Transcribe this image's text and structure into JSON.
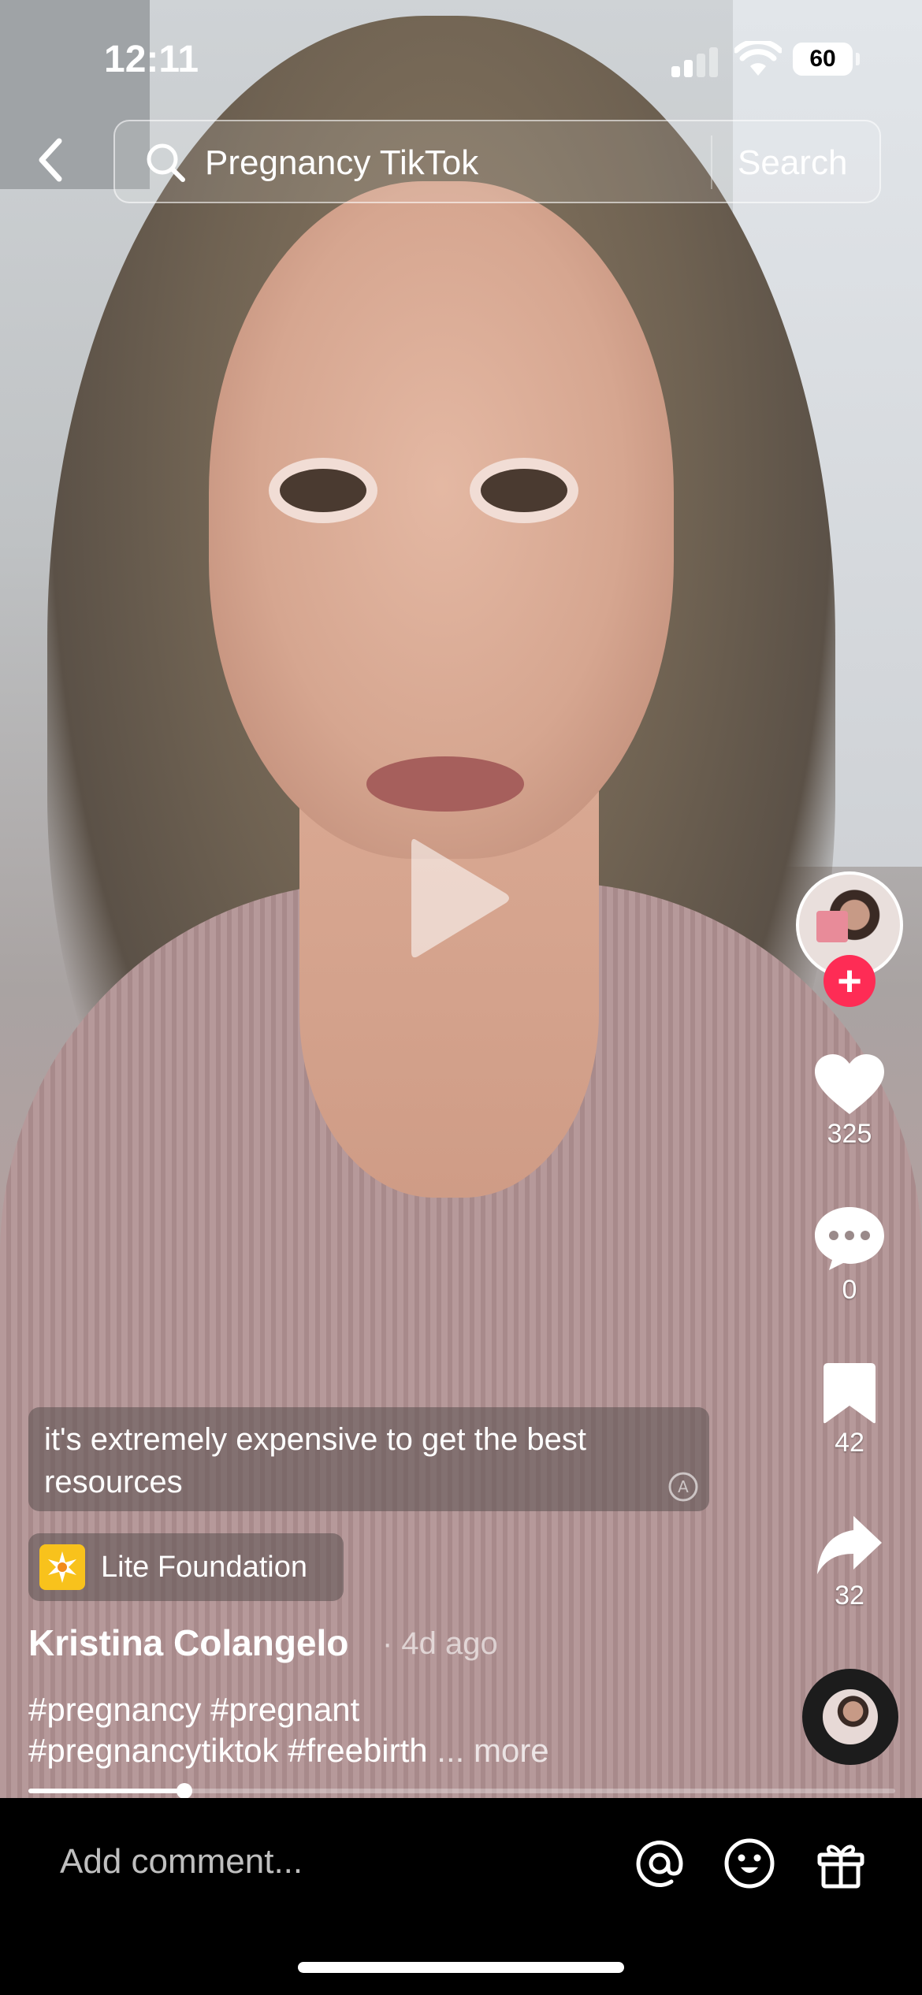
{
  "status_bar": {
    "time": "12:11",
    "battery": "60"
  },
  "search": {
    "query": "Pregnancy TikTok",
    "button_label": "Search"
  },
  "rail": {
    "likes": "325",
    "comments": "0",
    "saves": "42",
    "shares": "32",
    "follow_symbol": "+"
  },
  "caption": {
    "text": "it's extremely expensive to get the best resources"
  },
  "effect": {
    "label": "Lite Foundation"
  },
  "post": {
    "author": "Kristina Colangelo",
    "age": "· 4d ago",
    "hashtags_line1": "#pregnancy #pregnant",
    "hashtags_line2": "#pregnancytiktok #freebirth",
    "more_label": "... more"
  },
  "playback": {
    "progress": 0.18
  },
  "comment_bar": {
    "placeholder": "Add comment..."
  },
  "icons": {
    "back": "chevron-left-icon",
    "search": "search-icon",
    "play": "play-icon",
    "like": "heart-icon",
    "comment": "comment-bubble-icon",
    "save": "bookmark-icon",
    "share": "share-arrow-icon",
    "mention": "at-sign-icon",
    "emoji": "emoji-icon",
    "gift": "gift-icon"
  },
  "colors": {
    "follow_accent": "#fe2c55",
    "effect_badge": "#f8c21c"
  }
}
